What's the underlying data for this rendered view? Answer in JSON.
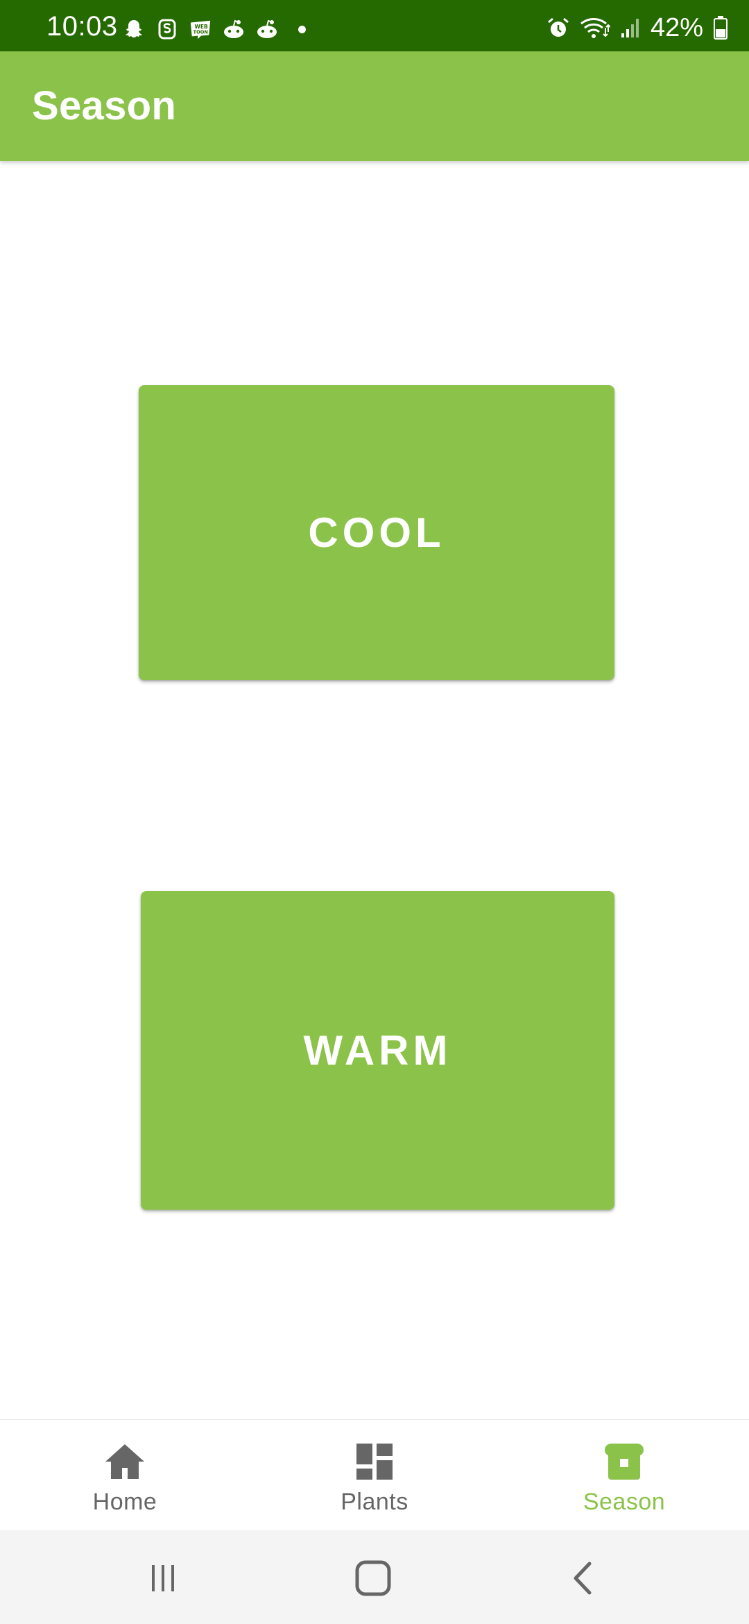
{
  "status_bar": {
    "time": "10:03",
    "notification_icons": [
      "snapchat-icon",
      "cash-app-icon",
      "webtoon-icon",
      "reddit-icon",
      "reddit-icon",
      "more-dot-icon"
    ],
    "system_icons": [
      "alarm-icon",
      "wifi-icon",
      "signal-icon",
      "battery-icon"
    ],
    "battery_percent": "42%"
  },
  "app_bar": {
    "title": "Season"
  },
  "buttons": {
    "cool_label": "COOL",
    "warm_label": "WARM"
  },
  "bottom_nav": {
    "items": [
      {
        "label": "Home",
        "icon": "home-icon",
        "active": false
      },
      {
        "label": "Plants",
        "icon": "dashboard-icon",
        "active": false
      },
      {
        "label": "Season",
        "icon": "bread-icon",
        "active": true
      }
    ]
  },
  "colors": {
    "status_bar": "#256a00",
    "accent": "#8bc34a",
    "inactive_nav": "#666666",
    "system_nav_bg": "#f4f4f4"
  }
}
